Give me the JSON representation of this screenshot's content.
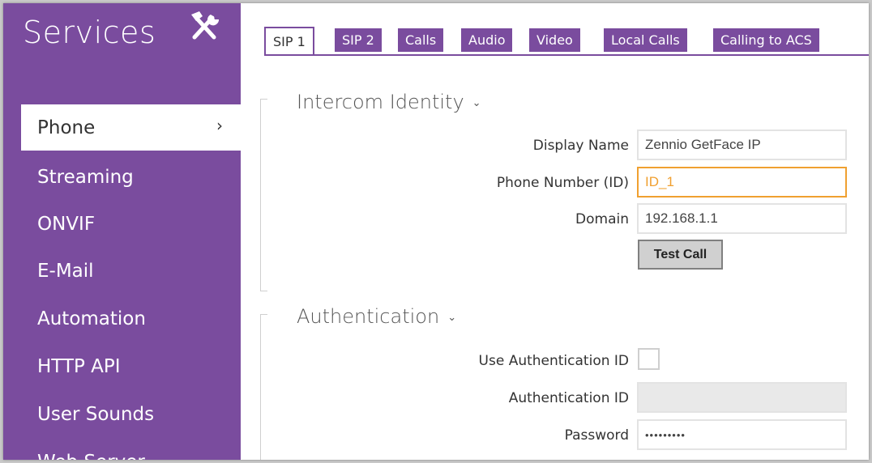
{
  "sidebar": {
    "title": "Services",
    "items": [
      {
        "label": "Phone",
        "chevron": "›"
      },
      {
        "label": "Streaming"
      },
      {
        "label": "ONVIF"
      },
      {
        "label": "E-Mail"
      },
      {
        "label": "Automation"
      },
      {
        "label": "HTTP API"
      },
      {
        "label": "User Sounds"
      },
      {
        "label": "Web Server"
      }
    ]
  },
  "tabs": [
    "SIP 1",
    "SIP 2",
    "Calls",
    "Audio",
    "Video",
    "Local Calls",
    "Calling to ACS"
  ],
  "intercom_identity": {
    "title": "Intercom Identity",
    "chevron": "⌄",
    "display_name_label": "Display Name",
    "display_name_value": "Zennio GetFace IP",
    "phone_number_label": "Phone Number (ID)",
    "phone_number_value": "ID_1",
    "domain_label": "Domain",
    "domain_value": "192.168.1.1",
    "test_call_label": "Test Call"
  },
  "authentication": {
    "title": "Authentication",
    "chevron": "⌄",
    "use_auth_id_label": "Use Authentication ID",
    "auth_id_label": "Authentication ID",
    "auth_id_value": "",
    "password_label": "Password",
    "password_value": "•••••••••"
  },
  "colors": {
    "accent": "#7a4c9e",
    "focus": "#f0a030"
  },
  "icons": {
    "services": "tools-icon"
  }
}
